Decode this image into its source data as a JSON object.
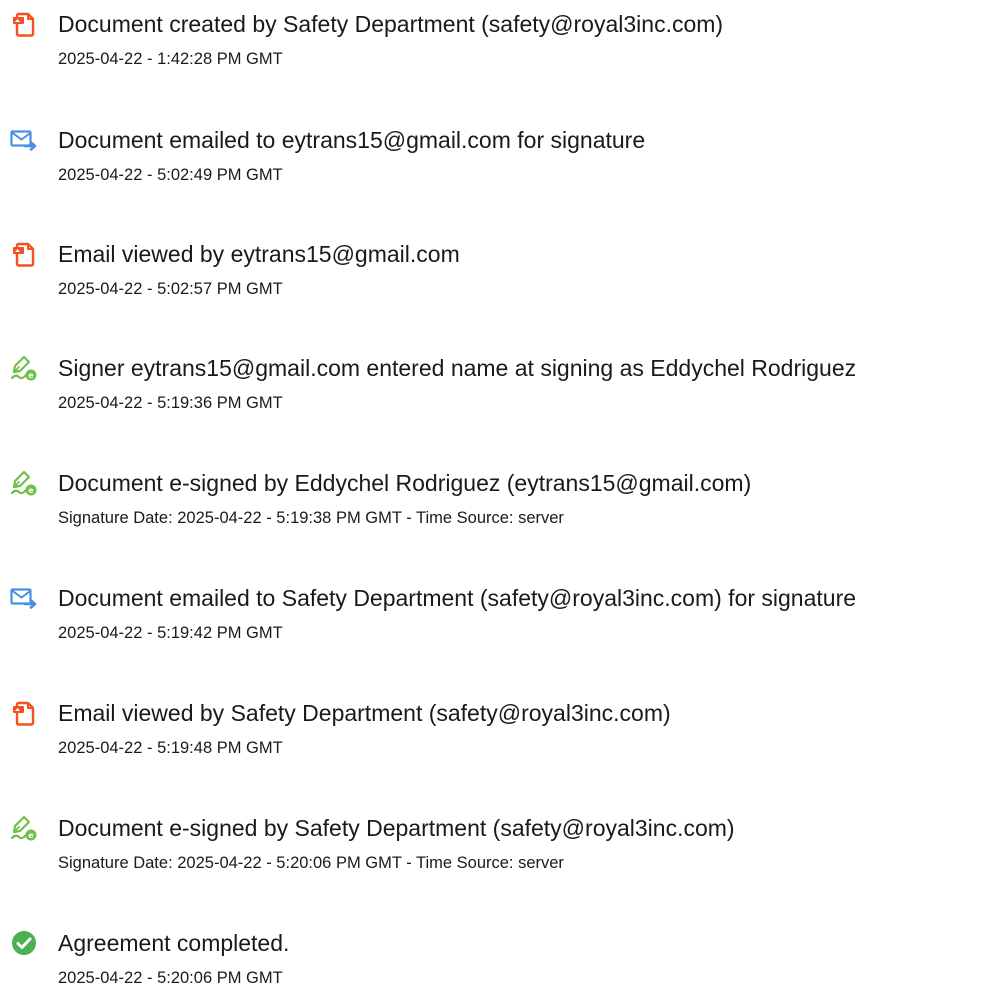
{
  "audit_events": [
    {
      "icon": "document-created-icon",
      "title": "Document created by Safety Department (safety@royal3inc.com)",
      "date": "2025-04-22 - 1:42:28 PM GMT"
    },
    {
      "icon": "email-sent-icon",
      "title": "Document emailed to eytrans15@gmail.com for signature",
      "date": "2025-04-22 - 5:02:49 PM GMT"
    },
    {
      "icon": "email-viewed-icon",
      "title": "Email viewed by eytrans15@gmail.com",
      "date": "2025-04-22 - 5:02:57 PM GMT"
    },
    {
      "icon": "e-sign-icon",
      "title": "Signer eytrans15@gmail.com entered name at signing as Eddychel Rodriguez",
      "date": "2025-04-22 - 5:19:36 PM GMT"
    },
    {
      "icon": "e-sign-icon",
      "title": "Document e-signed by Eddychel Rodriguez (eytrans15@gmail.com)",
      "date": "Signature Date: 2025-04-22 - 5:19:38 PM GMT - Time Source: server"
    },
    {
      "icon": "email-sent-icon",
      "title": "Document emailed to Safety Department (safety@royal3inc.com) for signature",
      "date": "2025-04-22 - 5:19:42 PM GMT"
    },
    {
      "icon": "email-viewed-icon",
      "title": "Email viewed by Safety Department (safety@royal3inc.com)",
      "date": "2025-04-22 - 5:19:48 PM GMT"
    },
    {
      "icon": "e-sign-icon",
      "title": "Document e-signed by Safety Department (safety@royal3inc.com)",
      "date": "Signature Date: 2025-04-22 - 5:20:06 PM GMT - Time Source: server"
    },
    {
      "icon": "agreement-completed-icon",
      "title": "Agreement completed.",
      "date": "2025-04-22 - 5:20:06 PM GMT"
    }
  ],
  "colors": {
    "document_icon": "#f4511e",
    "email_icon": "#4a90e2",
    "sign_icon": "#6fbf4a",
    "complete_icon": "#4caf50",
    "text": "#1a1a1a"
  }
}
